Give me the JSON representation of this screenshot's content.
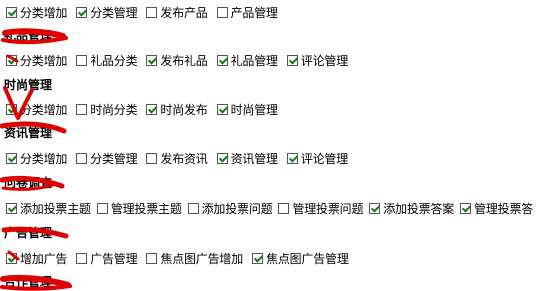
{
  "sections": [
    {
      "title": "",
      "items": [
        {
          "label": "分类增加",
          "checked": true
        },
        {
          "label": "分类管理",
          "checked": true
        },
        {
          "label": "发布产品",
          "checked": false
        },
        {
          "label": "产品管理",
          "checked": false
        }
      ]
    },
    {
      "title": "礼品管理",
      "items": [
        {
          "label": "分类增加",
          "checked": true
        },
        {
          "label": "礼品分类",
          "checked": false
        },
        {
          "label": "发布礼品",
          "checked": true
        },
        {
          "label": "礼品管理",
          "checked": true
        },
        {
          "label": "评论管理",
          "checked": true
        }
      ]
    },
    {
      "title": "时尚管理",
      "items": [
        {
          "label": "分类增加",
          "checked": true
        },
        {
          "label": "时尚分类",
          "checked": false
        },
        {
          "label": "时尚发布",
          "checked": true
        },
        {
          "label": "时尚管理",
          "checked": true
        }
      ]
    },
    {
      "title": "资讯管理",
      "items": [
        {
          "label": "分类增加",
          "checked": true
        },
        {
          "label": "分类管理",
          "checked": false
        },
        {
          "label": "发布资讯",
          "checked": false
        },
        {
          "label": "资讯管理",
          "checked": true
        },
        {
          "label": "评论管理",
          "checked": true
        }
      ]
    },
    {
      "title": "问卷调查",
      "items": [
        {
          "label": "添加投票主题",
          "checked": true
        },
        {
          "label": "管理投票主题",
          "checked": false
        },
        {
          "label": "添加投票问题",
          "checked": false
        },
        {
          "label": "管理投票问题",
          "checked": false
        },
        {
          "label": "添加投票答案",
          "checked": true
        },
        {
          "label": "管理投票答",
          "checked": true
        }
      ]
    },
    {
      "title": "广告管理",
      "items": [
        {
          "label": "增加广告",
          "checked": true
        },
        {
          "label": "广告管理",
          "checked": false
        },
        {
          "label": "焦点图广告增加",
          "checked": false
        },
        {
          "label": "焦点图广告管理",
          "checked": true
        }
      ]
    },
    {
      "title": "合作管理",
      "items": []
    }
  ],
  "colors": {
    "check": "#1a7a1a",
    "redaction": "#e00000"
  }
}
